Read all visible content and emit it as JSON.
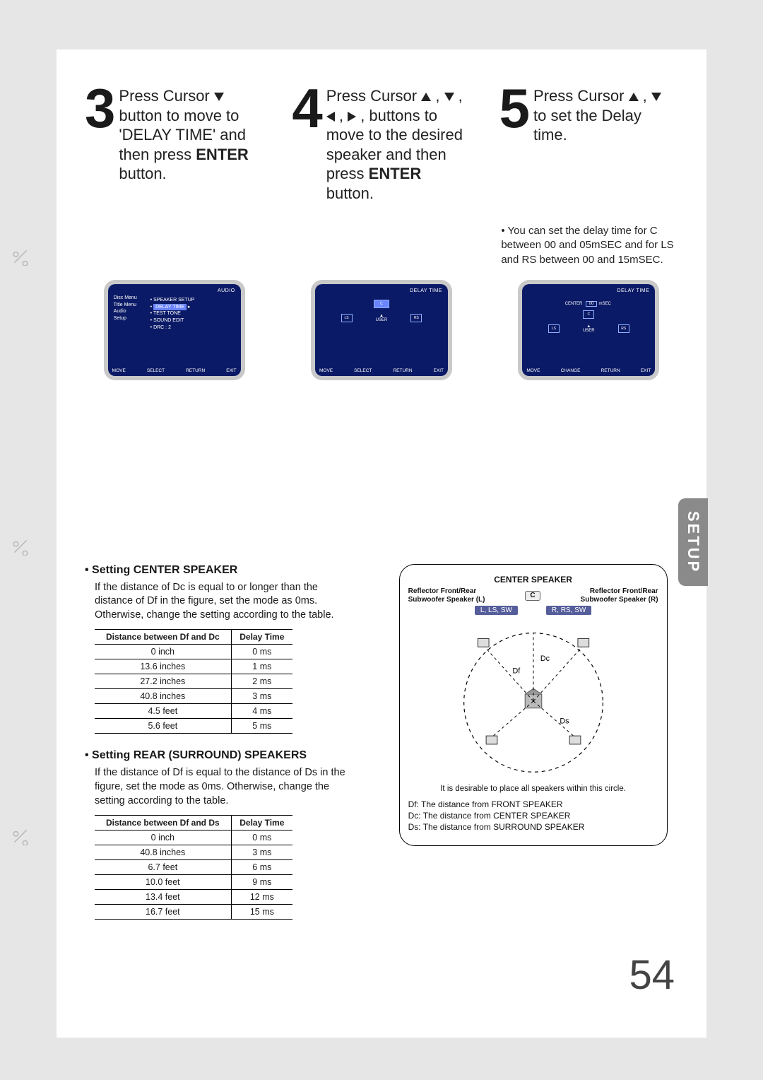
{
  "page_number": "54",
  "setup_tab": "SETUP",
  "steps": {
    "s3": {
      "num": "3",
      "line1": "Press Cursor ",
      "line2_a": " button to move to 'DELAY TIME' and then press ",
      "enter": "ENTER",
      "line2_b": " button."
    },
    "s4": {
      "num": "4",
      "line1_a": "Press Cursor ",
      "line1_b": ",  ,",
      "line2_a": " ,  buttons to move to the desired speaker and then press ",
      "enter": "ENTER",
      "line2_b": " button."
    },
    "s5": {
      "num": "5",
      "line": "Press Cursor  ,  to set the Delay time."
    }
  },
  "note5": "You can set the delay time for C between 00 and 05mSEC and for LS and RS between 00 and 15mSEC.",
  "crt": {
    "m3": {
      "hdr_left": "",
      "hdr_right": "AUDIO",
      "left_menu": [
        "Disc Menu",
        "Title Menu",
        "Audio",
        "Setup"
      ],
      "right_menu": [
        "SPEAKER SETUP",
        "DELAY TIME",
        "TEST TONE",
        "SOUND EDIT",
        "DRC              : 2"
      ],
      "highlight_index": 1,
      "footer": [
        "MOVE",
        "SELECT",
        "RETURN",
        "EXIT"
      ]
    },
    "m4": {
      "hdr_right": "DELAY TIME",
      "footer": [
        "MOVE",
        "SELECT",
        "RETURN",
        "EXIT"
      ]
    },
    "m5": {
      "hdr_right": "DELAY TIME",
      "center_label": "CENTER",
      "center_value": "00",
      "ms": "mSEC",
      "footer": [
        "MOVE",
        "CHANGE",
        "RETURN",
        "EXIT"
      ]
    }
  },
  "center_section": {
    "heading": "Setting CENTER SPEAKER",
    "body": "If the distance of Dc is equal to or longer than the distance of Df in the figure, set the mode as 0ms. Otherwise, change the setting according to the table.",
    "table": {
      "head": [
        "Distance between Df and Dc",
        "Delay Time"
      ],
      "rows": [
        [
          "0 inch",
          "0 ms"
        ],
        [
          "13.6 inches",
          "1 ms"
        ],
        [
          "27.2 inches",
          "2 ms"
        ],
        [
          "40.8 inches",
          "3 ms"
        ],
        [
          "4.5 feet",
          "4 ms"
        ],
        [
          "5.6 feet",
          "5 ms"
        ]
      ]
    }
  },
  "rear_section": {
    "heading": "Setting REAR (SURROUND) SPEAKERS",
    "body": "If the distance of Df is equal to the distance of Ds in the figure, set the mode as 0ms. Otherwise, change the setting according to the table.",
    "table": {
      "head": [
        "Distance between Df and Ds",
        "Delay Time"
      ],
      "rows": [
        [
          "0 inch",
          "0 ms"
        ],
        [
          "40.8 inches",
          "3 ms"
        ],
        [
          "6.7 feet",
          "6 ms"
        ],
        [
          "10.0 feet",
          "9 ms"
        ],
        [
          "13.4 feet",
          "12 ms"
        ],
        [
          "16.7 feet",
          "15 ms"
        ]
      ]
    }
  },
  "diagram": {
    "title": "CENTER SPEAKER",
    "left_label_a": "Reflector Front/Rear",
    "left_label_b": "Subwoofer Speaker (L)",
    "right_label_a": "Reflector Front/Rear",
    "right_label_b": "Subwoofer Speaker (R)",
    "c_chip": "C",
    "chip_l": "L, LS, SW",
    "chip_r": "R, RS, SW",
    "dc": "Dc",
    "df": "Df",
    "ds": "Ds",
    "caption": "It is desirable to place all speakers within this circle.",
    "legend": [
      "Df: The distance from FRONT SPEAKER",
      "Dc: The distance from CENTER SPEAKER",
      "Ds: The distance from SURROUND SPEAKER"
    ]
  }
}
